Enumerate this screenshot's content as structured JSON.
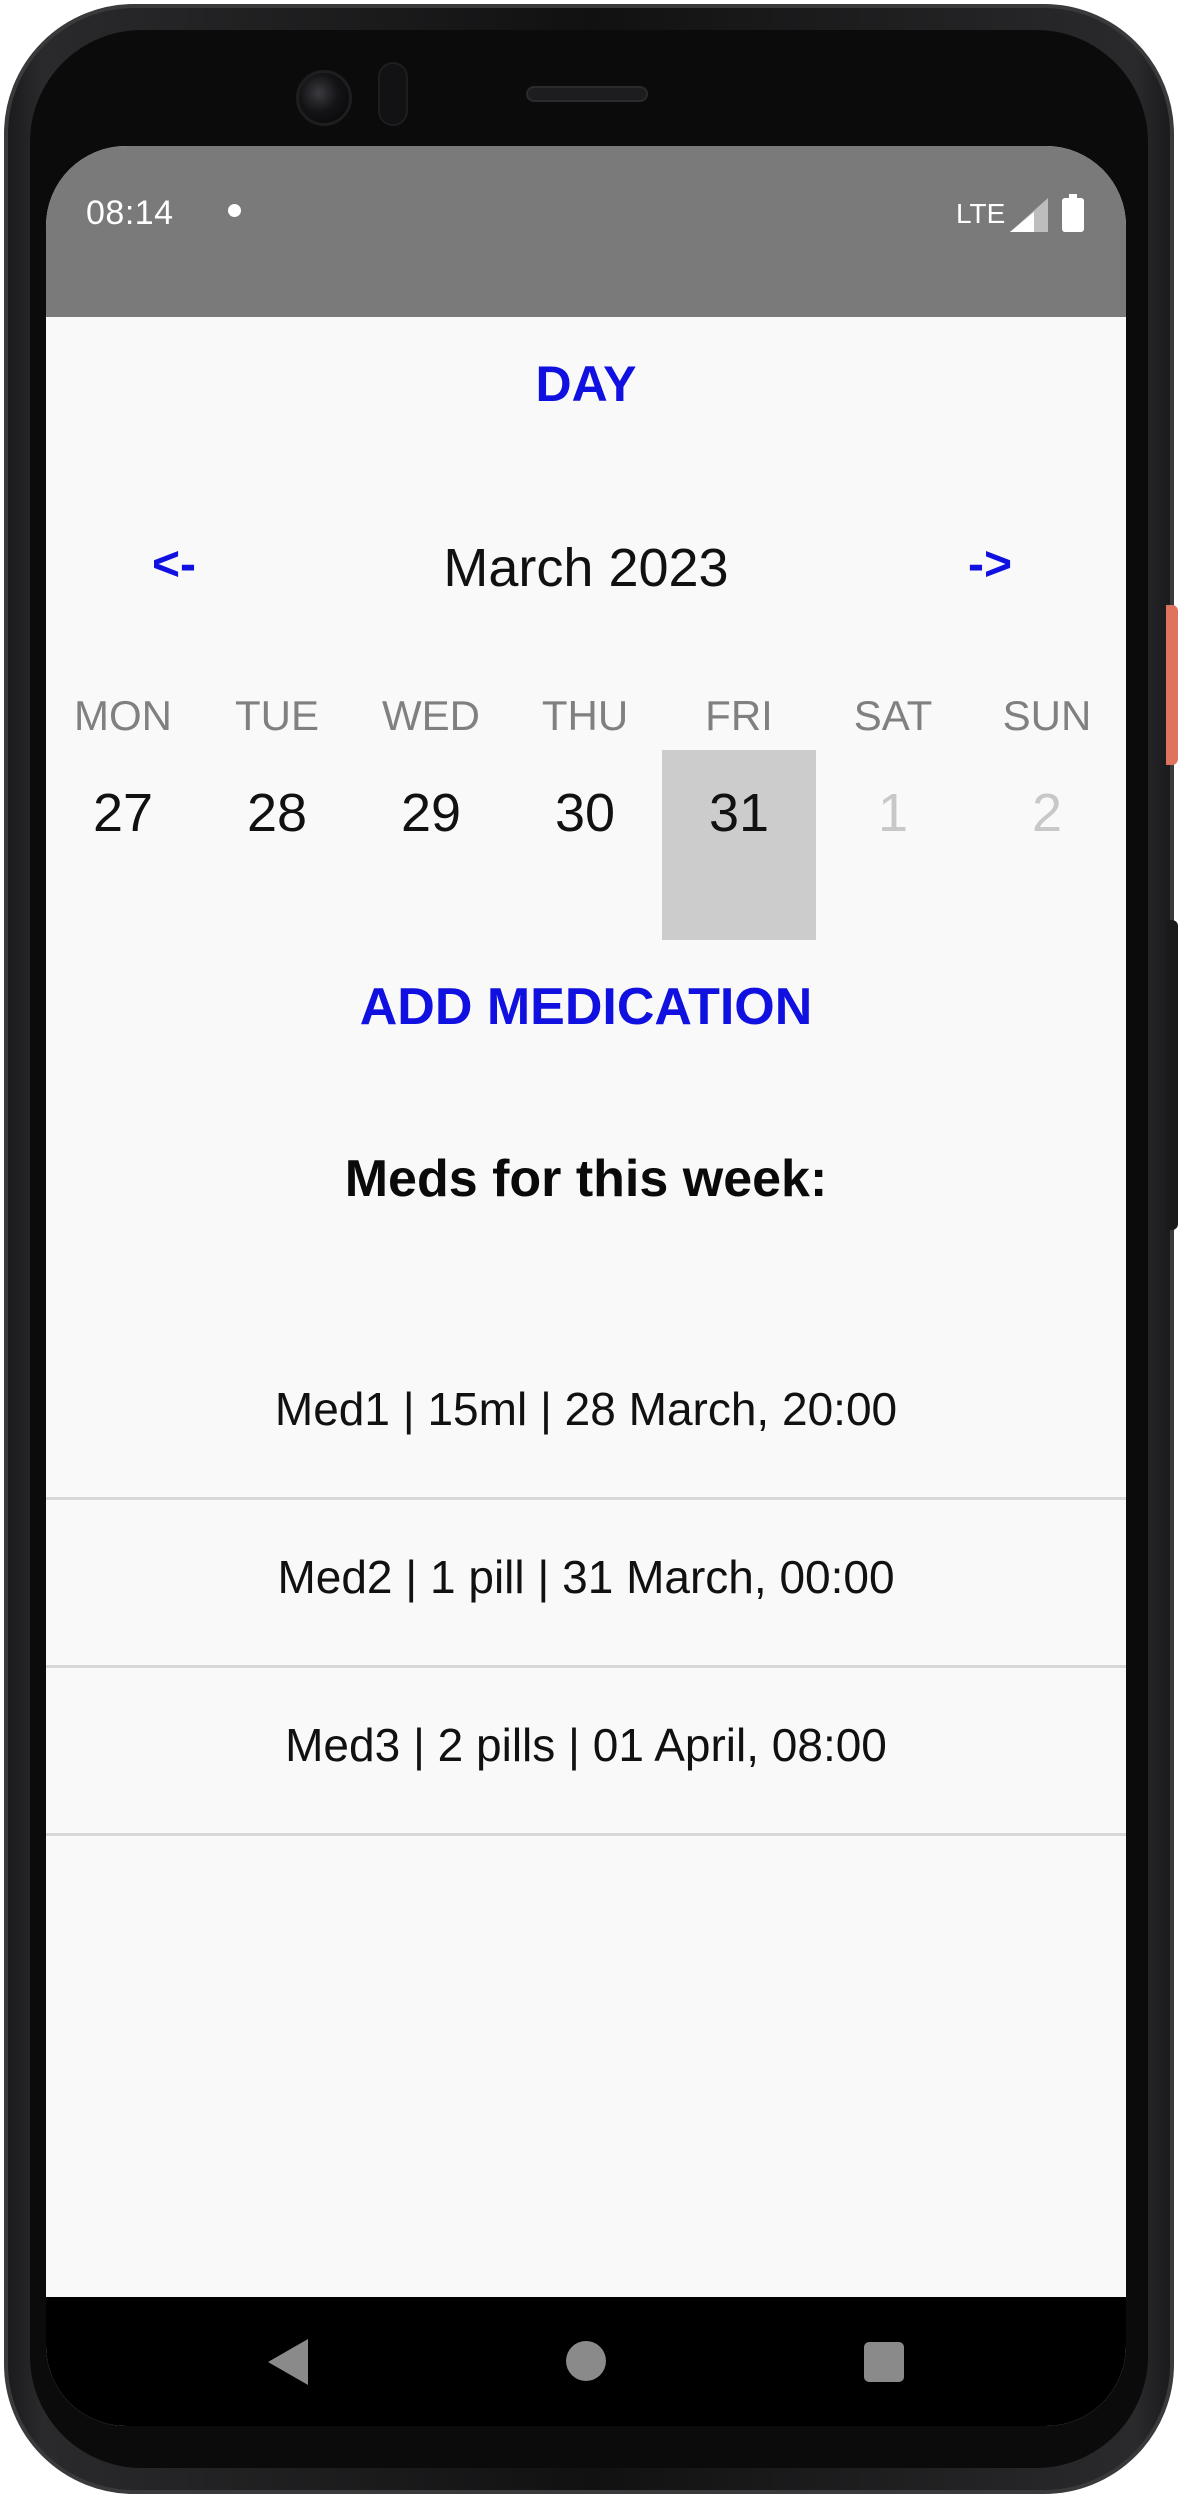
{
  "status_bar": {
    "time": "08:14",
    "network": "LTE",
    "icons": [
      "notification-dot-icon",
      "signal-icon",
      "battery-icon"
    ]
  },
  "header": {
    "view_mode": "DAY"
  },
  "calendar": {
    "prev_label": "<-",
    "next_label": "->",
    "month": "March 2023",
    "days": [
      {
        "dow": "MON",
        "num": "27",
        "muted": false,
        "selected": false
      },
      {
        "dow": "TUE",
        "num": "28",
        "muted": false,
        "selected": false
      },
      {
        "dow": "WED",
        "num": "29",
        "muted": false,
        "selected": false
      },
      {
        "dow": "THU",
        "num": "30",
        "muted": false,
        "selected": false
      },
      {
        "dow": "FRI",
        "num": "31",
        "muted": false,
        "selected": true
      },
      {
        "dow": "SAT",
        "num": "1",
        "muted": true,
        "selected": false
      },
      {
        "dow": "SUN",
        "num": "2",
        "muted": true,
        "selected": false
      }
    ]
  },
  "actions": {
    "add_medication": "ADD MEDICATION"
  },
  "meds": {
    "title": "Meds for this week:",
    "items": [
      "Med1 | 15ml | 28 March, 20:00",
      "Med2 | 1 pill | 31 March, 00:00",
      "Med3 | 2 pills | 01 April, 08:00"
    ]
  },
  "colors": {
    "accent": "#1010e0",
    "status_bar": "#7a7a7a",
    "selected_day": "#cccccc",
    "background": "#f9f9f9"
  },
  "nav_bar": {
    "icons": [
      "back-icon",
      "home-icon",
      "recents-icon"
    ]
  }
}
